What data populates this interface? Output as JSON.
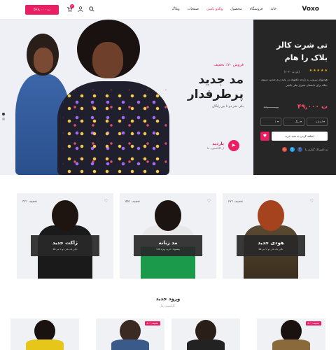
{
  "header": {
    "logo": "Voxo",
    "nav": [
      "خانه",
      "فروشگاه",
      "محصول",
      "والدو پاشی",
      "صفحات",
      "وبلاگ"
    ],
    "nav_accent_index": 3,
    "cart_total": "۵۶۸,۰۰۰ ت",
    "cart_count": "۲",
    "icons": [
      "search-icon",
      "user-icon",
      "heart-icon",
      "cart-icon"
    ]
  },
  "hero": {
    "sale_label": "فروش ۷۰٪ تخفیف",
    "title": "مد جدید پرطرفدار",
    "subtitle": "یکی بخر دو تا ببر رایگان",
    "cta_title": "بازدید",
    "cta_subtitle": "از کلکسیون ما"
  },
  "panel": {
    "title": "تی شرت کالر بلاک را هام",
    "rating": 5,
    "reviews": "(۶۰۳۰ بازدید)",
    "description": "هودیهای بیرونی به بارچه بافتهای به بخیه نرم چندین سیوی بیکه برای تابستان شیراز تبلی یکیتی.",
    "price_new": "۴۹,۰۰۰ ت",
    "price_old": "۹۹,۰۰۰ ت",
    "select_size": "اندازه",
    "select_color": "رنگ",
    "select_qty": "۱",
    "add_to_cart": "اضافه کردن به سبد خرید",
    "share_label": "به اشتراک گذاری با"
  },
  "categories": [
    {
      "title": "هودی جدید",
      "subtitle": "بگیر یک بخر دو تا ببر ۵۵",
      "discount": "۲۲٪ تخفیف"
    },
    {
      "title": "مد زنانه",
      "subtitle": "پیشنهاد: خرید ویژه ۱۵۵",
      "discount": "۵۵٪ تخفیف"
    },
    {
      "title": "ژاکت جدید",
      "subtitle": "بگیر یک بخر دو تا ببر ۵۵",
      "discount": "۳۲٪ تخفیف"
    }
  ],
  "new_arrivals": {
    "title": "ورود جدید",
    "subtitle": "کلکسیون ما",
    "badges": [
      "۵۰٪ تخفیف",
      "",
      "۵۰٪ تخفیف",
      ""
    ]
  },
  "colors": {
    "accent": "#e91e63",
    "panel_bg": "#262626",
    "hero_bg": "#eef0f5",
    "card_bg": "#f0f1f4"
  }
}
